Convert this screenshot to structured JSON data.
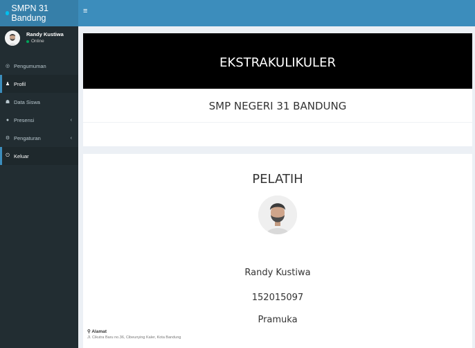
{
  "header": {
    "brand": "SMPN 31 Bandung",
    "toggle": "≡"
  },
  "user": {
    "name": "Randy Kustiwa",
    "status": "Online"
  },
  "menu": [
    {
      "icon": "bell-icon",
      "glyph": "◎",
      "label": "Pengumuman"
    },
    {
      "icon": "user-icon",
      "glyph": "♟",
      "label": "Profil"
    },
    {
      "icon": "users-icon",
      "glyph": "☗",
      "label": "Data Siswa"
    },
    {
      "icon": "check-icon",
      "glyph": "●",
      "label": "Presensi"
    },
    {
      "icon": "gear-icon",
      "glyph": "⚙",
      "label": "Pengaturan"
    },
    {
      "icon": "power-icon",
      "glyph": "⏻",
      "label": "Keluar"
    }
  ],
  "menu_chevron": "‹",
  "content": {
    "title": "EKSTRAKULIKULER",
    "school": "SMP NEGERI 31 BANDUNG",
    "section_title": "PELATIH",
    "coach_name": "Randy Kustiwa",
    "coach_id": "152015097",
    "coach_ekskul": "Pramuka",
    "address_label": "Alamat",
    "address_icon": "map-marker-icon",
    "address_value": "Jl. Cikutra Baru no.36, Cibeunying Kaler, Kota Bandung"
  }
}
